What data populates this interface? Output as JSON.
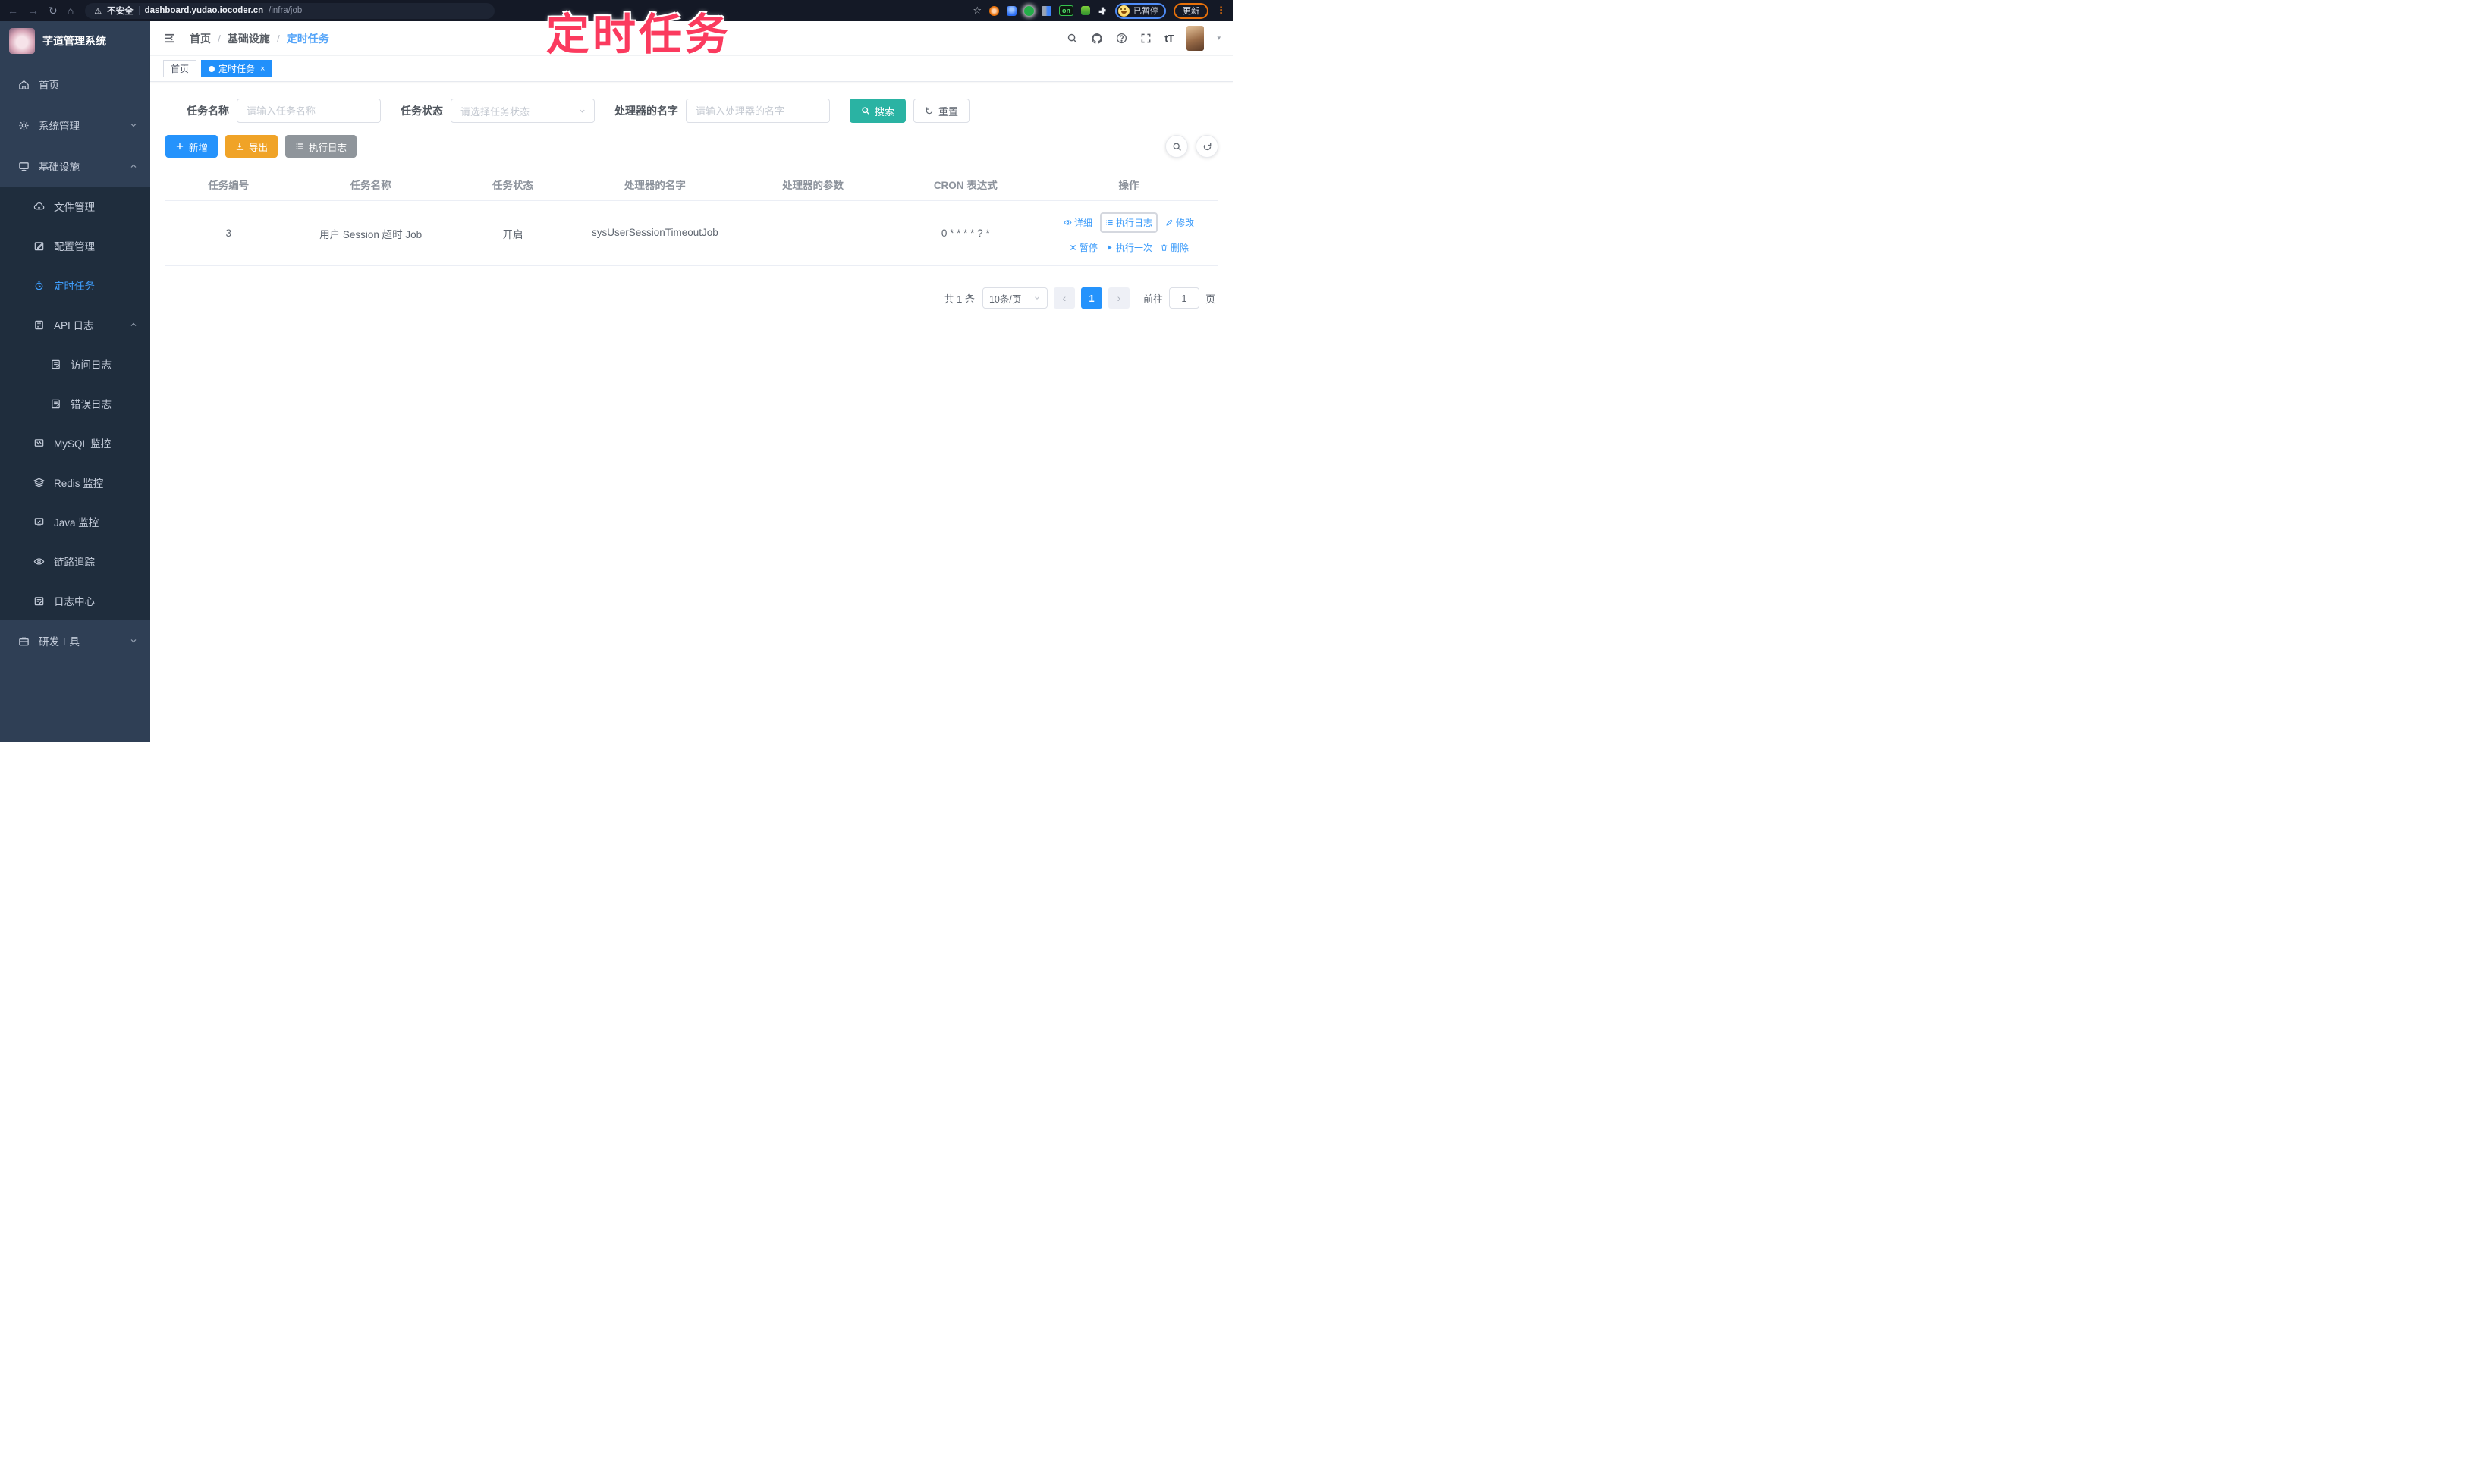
{
  "browser": {
    "icons": {
      "back": "←",
      "forward": "→",
      "reload": "↻",
      "home": "⌂",
      "warning": "⚠",
      "star": "☆",
      "menu": "⋮",
      "caret": "▾"
    },
    "security_label": "不安全",
    "url_host": "dashboard.yudao.iocoder.cn",
    "url_path": "/infra/job",
    "extension_on_badge": "on",
    "profile_status": "已暂停",
    "update_button": "更新"
  },
  "annotation": {
    "text": "定时任务",
    "color": "#fb3a5e"
  },
  "sidebar": {
    "title": "芋道管理系统",
    "items": [
      {
        "label": "首页"
      },
      {
        "label": "系统管理"
      },
      {
        "label": "基础设施"
      },
      {
        "label": "文件管理"
      },
      {
        "label": "配置管理"
      },
      {
        "label": "定时任务"
      },
      {
        "label": "API 日志"
      },
      {
        "label": "访问日志"
      },
      {
        "label": "错误日志"
      },
      {
        "label": "MySQL 监控"
      },
      {
        "label": "Redis 监控"
      },
      {
        "label": "Java 监控"
      },
      {
        "label": "链路追踪"
      },
      {
        "label": "日志中心"
      },
      {
        "label": "研发工具"
      }
    ]
  },
  "header": {
    "breadcrumb": [
      "首页",
      "基础设施",
      "定时任务"
    ],
    "separator": "/",
    "font_size_glyph": "tT"
  },
  "tags": {
    "home": "首页",
    "active": "定时任务",
    "close_glyph": "×"
  },
  "filter": {
    "name_label": "任务名称",
    "name_placeholder": "请输入任务名称",
    "status_label": "任务状态",
    "status_placeholder": "请选择任务状态",
    "handler_label": "处理器的名字",
    "handler_placeholder": "请输入处理器的名字",
    "search": "搜索",
    "reset": "重置"
  },
  "toolbar": {
    "add": "新增",
    "export": "导出",
    "exec_log": "执行日志"
  },
  "table": {
    "columns": [
      "任务编号",
      "任务名称",
      "任务状态",
      "处理器的名字",
      "处理器的参数",
      "CRON 表达式",
      "操作"
    ],
    "row": {
      "id": "3",
      "name": "用户 Session 超时 Job",
      "status": "开启",
      "handler": "sysUserSessionTimeoutJob",
      "param": "",
      "cron": "0 * * * * ? *"
    },
    "actions": [
      "详细",
      "执行日志",
      "修改",
      "暂停",
      "执行一次",
      "删除"
    ]
  },
  "pagination": {
    "total": "共 1 条",
    "size": "10条/页",
    "prev": "‹",
    "page": "1",
    "next": "›",
    "goto": "前往",
    "goto_value": "1",
    "unit": "页"
  },
  "colors": {
    "primary": "#2593fc",
    "sidebar_bg": "#2f3f55",
    "submenu_bg": "#1f2d3d",
    "teal": "#2ab3a3",
    "warning": "#f0a327",
    "info": "#8f959b",
    "annotation": "#fb3a5e"
  }
}
